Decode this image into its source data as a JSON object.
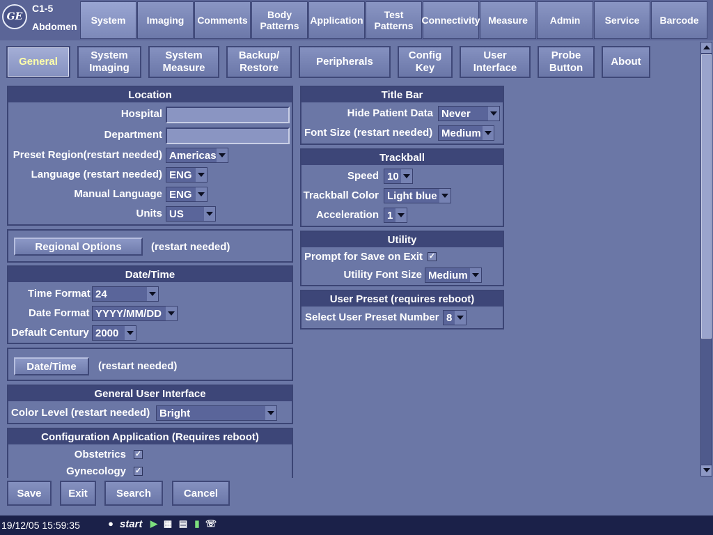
{
  "header": {
    "logo_text": "GE",
    "probe": "C1-5",
    "preset": "Abdomen",
    "tabs": [
      {
        "label": "System"
      },
      {
        "label": "Imaging"
      },
      {
        "label": "Comments"
      },
      {
        "label": "Body\nPatterns"
      },
      {
        "label": "Application"
      },
      {
        "label": "Test\nPatterns"
      },
      {
        "label": "Connectivity"
      },
      {
        "label": "Measure"
      },
      {
        "label": "Admin"
      },
      {
        "label": "Service"
      },
      {
        "label": "Barcode"
      }
    ],
    "active_tab": "System"
  },
  "subtabs": [
    {
      "label": "General"
    },
    {
      "label": "System\nImaging"
    },
    {
      "label": "System\nMeasure"
    },
    {
      "label": "Backup/\nRestore"
    },
    {
      "label": "Peripherals"
    },
    {
      "label": "Config\nKey"
    },
    {
      "label": "User\nInterface"
    },
    {
      "label": "Probe\nButton"
    },
    {
      "label": "About"
    }
  ],
  "location": {
    "title": "Location",
    "hospital_label": "Hospital",
    "hospital_value": "",
    "department_label": "Department",
    "department_value": "",
    "preset_region_label": "Preset Region(restart needed)",
    "preset_region_value": "Americas",
    "language_label": "Language (restart needed)",
    "language_value": "ENG",
    "manual_language_label": "Manual Language",
    "manual_language_value": "ENG",
    "units_label": "Units",
    "units_value": "US"
  },
  "regional": {
    "button_label": "Regional Options",
    "note": "(restart needed)"
  },
  "datetime": {
    "title": "Date/Time",
    "time_format_label": "Time Format",
    "time_format_value": "24",
    "date_format_label": "Date Format",
    "date_format_value": "YYYY/MM/DD",
    "default_century_label": "Default Century",
    "default_century_value": "2000",
    "button_label": "Date/Time",
    "note": "(restart needed)"
  },
  "general_ui": {
    "title": "General User Interface",
    "color_level_label": "Color Level (restart needed)",
    "color_level_value": "Bright"
  },
  "config_app": {
    "title": "Configuration Application (Requires reboot)",
    "obstetrics_label": "Obstetrics",
    "obstetrics_checked": true,
    "gynecology_label": "Gynecology",
    "gynecology_checked": true,
    "check_mark": "✓"
  },
  "title_bar": {
    "title": "Title Bar",
    "hide_patient_label": "Hide Patient Data",
    "hide_patient_value": "Never",
    "font_size_label": "Font Size (restart needed)",
    "font_size_value": "Medium"
  },
  "trackball": {
    "title": "Trackball",
    "speed_label": "Speed",
    "speed_value": "10",
    "color_label": "Trackball Color",
    "color_value": "Light blue",
    "accel_label": "Acceleration",
    "accel_value": "1"
  },
  "utility": {
    "title": "Utility",
    "prompt_save_label": "Prompt for Save on Exit",
    "prompt_save_checked": true,
    "font_size_label": "Utility Font Size",
    "font_size_value": "Medium"
  },
  "user_preset": {
    "title": "User Preset (requires reboot)",
    "select_label": "Select User Preset Number",
    "select_value": "8"
  },
  "footer": {
    "save": "Save",
    "exit": "Exit",
    "search": "Search",
    "cancel": "Cancel"
  },
  "taskbar": {
    "clock": "19/12/05 15:59:35",
    "start": "start",
    "tray_icons": [
      "lock-icon",
      "usb-icon",
      "network-icon",
      "wireless-icon",
      "battery-icon",
      "ge-icon"
    ]
  },
  "colors": {
    "background": "#6b77a6",
    "panel_header": "#3d4678",
    "active_subtab_text": "#ffffaa",
    "taskbar": "#1b2149"
  }
}
